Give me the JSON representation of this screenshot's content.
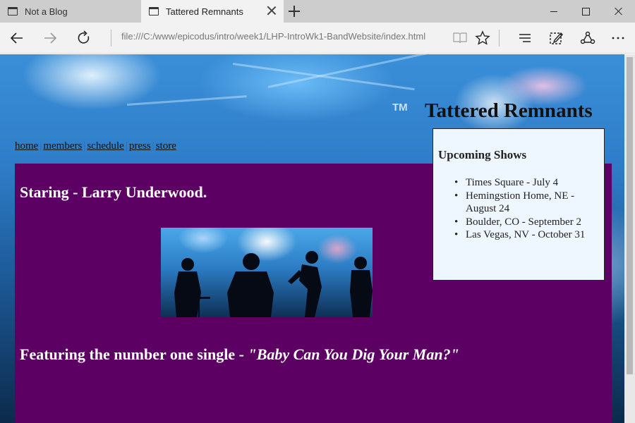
{
  "browser": {
    "tabs": [
      {
        "title": "Not a Blog",
        "active": false
      },
      {
        "title": "Tattered Remnants",
        "active": true
      }
    ],
    "url": "file:///C:/www/epicodus/intro/week1/LHP-IntroWk1-BandWebsite/index.html",
    "icons": [
      "back-icon",
      "forward-icon",
      "refresh-icon",
      "reading-view-icon",
      "favorite-star-icon",
      "hub-icon",
      "web-note-icon",
      "share-icon",
      "more-icon"
    ]
  },
  "page": {
    "band_title": "Tattered Remnants",
    "tm_mark": "TM",
    "nav": {
      "home": "home",
      "members": "members",
      "schedule": "schedule",
      "press": "press",
      "store": "store",
      "separator": "|"
    },
    "starring": "Staring - Larry Underwood.",
    "featuring_prefix": "Featuring the number one single - ",
    "featuring_song": "\"Baby Can You Dig Your Man?\"",
    "shows": {
      "heading": "Upcoming Shows",
      "items": [
        "Times Square - July 4",
        "Hemingstion Home, NE - August 24",
        "Boulder, CO - September 2",
        "Las Vegas, NV - October 31"
      ]
    },
    "colors": {
      "panel": "#5c0063",
      "shows_box": "#eef6ff"
    }
  }
}
